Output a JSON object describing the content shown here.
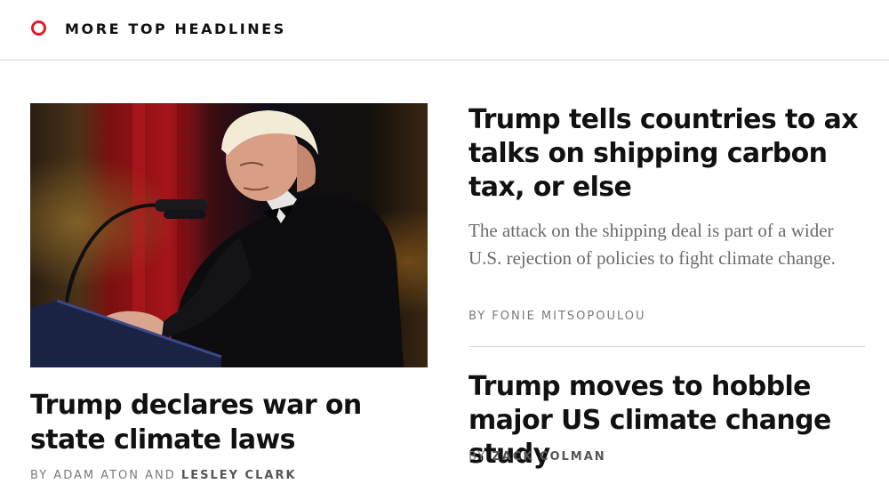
{
  "section": {
    "title": "MORE TOP HEADLINES",
    "icon": "ring-icon",
    "accent_color": "#e51b24"
  },
  "lead_story": {
    "headline": "Trump declares war on state climate laws",
    "byline_prefix": "BY",
    "author_1": "ADAM ATON",
    "conjunction": "AND",
    "author_2": "LESLEY CLARK"
  },
  "stories": [
    {
      "headline": "Trump tells countries to ax talks on shipping carbon tax, or else",
      "dek": "The attack on the shipping deal is part of a wider U.S. rejection of policies to fight climate change.",
      "byline_prefix": "BY",
      "author": "FONIE MITSOPOULOU"
    },
    {
      "headline": "Trump moves to hobble major US climate change study",
      "byline_prefix": "BY",
      "author": "ZACK COLMAN"
    }
  ]
}
